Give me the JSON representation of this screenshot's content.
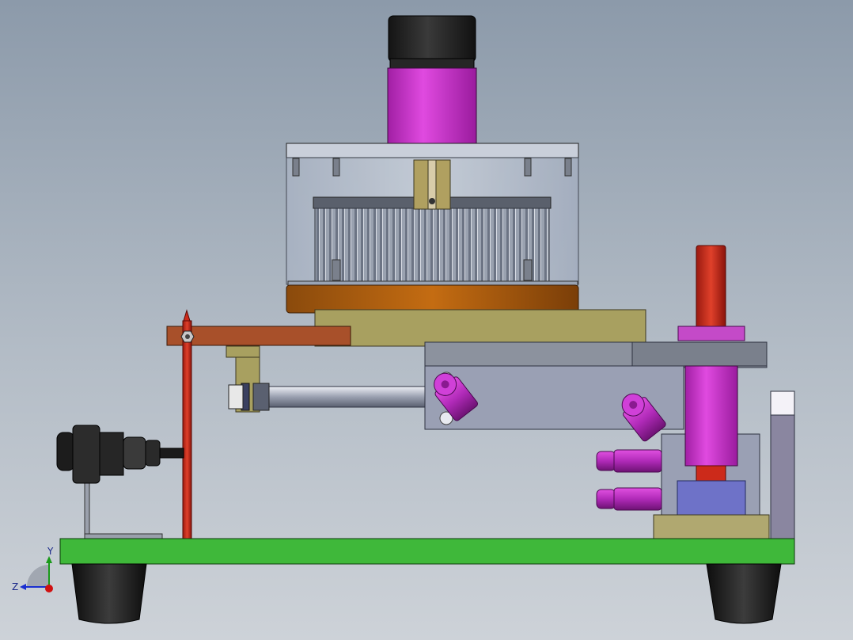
{
  "view": {
    "background_top": "#8c9aaa",
    "background_bottom": "#cdd2d8"
  },
  "triad": {
    "x_axis_color": "#d01010",
    "y_axis_color": "#1a9a1a",
    "z_axis_color": "#1a2fd0",
    "y_label": "Y",
    "z_label": "Z"
  },
  "parts": {
    "motor_color": "#cc33cc",
    "base_plate_color": "#3fb83a",
    "rod_color": "#cc2a1a",
    "flange_color": "#b4620f",
    "bracket_color": "#a8a060",
    "block_color": "#8f95a8",
    "foot_color": "#202020",
    "fitting_color": "#b02ab8"
  }
}
